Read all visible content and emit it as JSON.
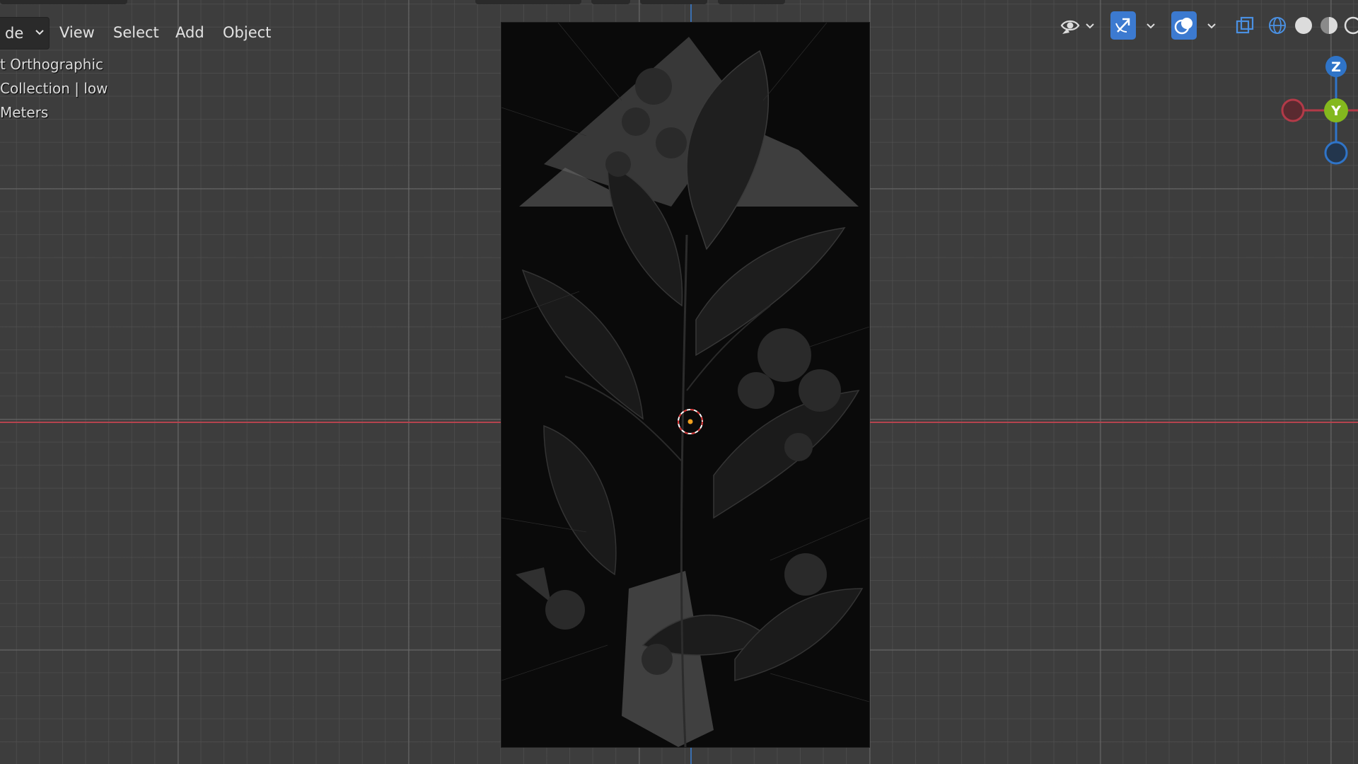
{
  "header": {
    "mode_label": "de",
    "menus": {
      "view": "View",
      "select": "Select",
      "add": "Add",
      "object": "Object"
    }
  },
  "overlay": {
    "view_name": "t Orthographic",
    "collection": "Collection | low",
    "units": "Meters"
  },
  "toolbar": {
    "icons": [
      "visibility-eye-icon",
      "gizmo-toggle-icon",
      "overlay-toggle-icon",
      "xray-toggle-icon",
      "wireframe-shading-icon",
      "solid-shading-icon",
      "material-shading-icon",
      "rendered-shading-icon"
    ],
    "active_color": "#3c7ad0"
  },
  "gizmo": {
    "z_label": "Z",
    "y_label": "Y",
    "colors": {
      "x": "#b33a48",
      "y": "#84b81e",
      "z": "#2f74c8"
    }
  },
  "colors": {
    "grid_bg": "#3d3d3d",
    "x_axis": "#b5444f",
    "z_axis": "#3a6fb0",
    "mesh": "#0a0a0a"
  }
}
